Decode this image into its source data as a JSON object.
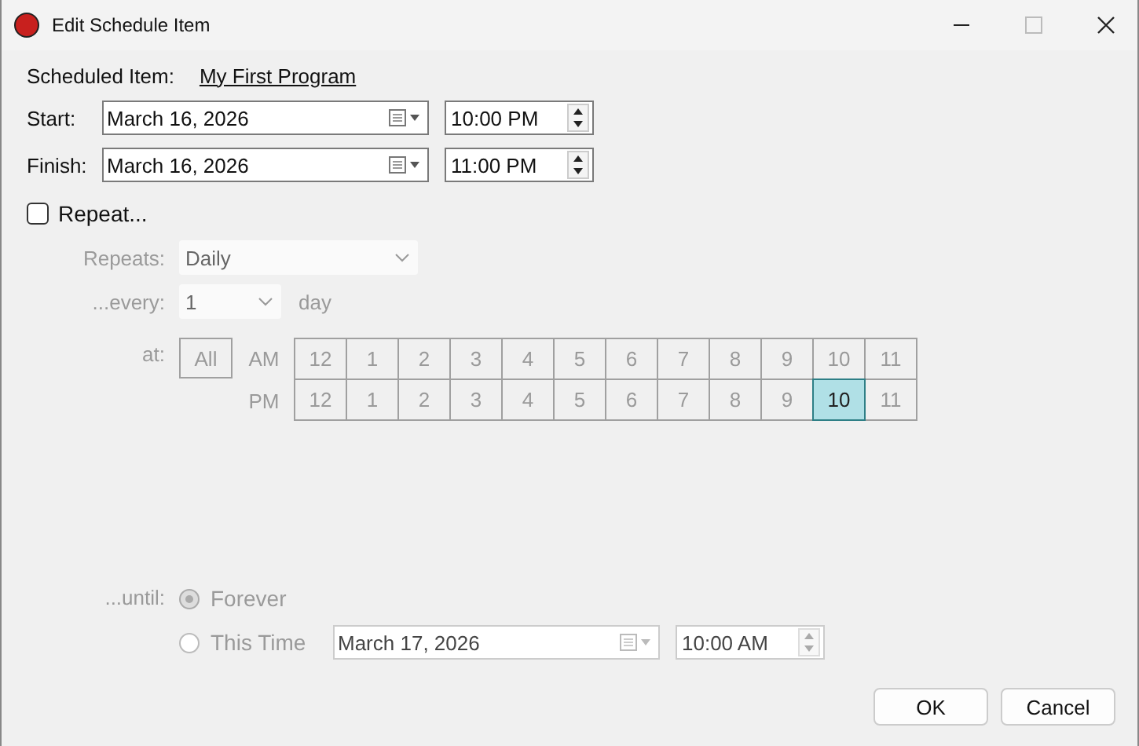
{
  "window": {
    "title": "Edit Schedule Item"
  },
  "scheduled_item": {
    "label": "Scheduled Item:",
    "value": "My First Program"
  },
  "start": {
    "label": "Start:",
    "date": "March 16, 2026",
    "time": "10:00 PM"
  },
  "finish": {
    "label": "Finish:",
    "date": "March 16, 2026",
    "time": "11:00 PM"
  },
  "repeat": {
    "label": "Repeat...",
    "checked": false
  },
  "repeats": {
    "label": "Repeats:",
    "value": "Daily"
  },
  "every": {
    "label": "...every:",
    "value": "1",
    "unit": "day"
  },
  "at": {
    "label": "at:",
    "all_button": "All",
    "rows": [
      {
        "label": "AM",
        "hours": [
          {
            "label": "12",
            "selected": false
          },
          {
            "label": "1",
            "selected": false
          },
          {
            "label": "2",
            "selected": false
          },
          {
            "label": "3",
            "selected": false
          },
          {
            "label": "4",
            "selected": false
          },
          {
            "label": "5",
            "selected": false
          },
          {
            "label": "6",
            "selected": false
          },
          {
            "label": "7",
            "selected": false
          },
          {
            "label": "8",
            "selected": false
          },
          {
            "label": "9",
            "selected": false
          },
          {
            "label": "10",
            "selected": false
          },
          {
            "label": "11",
            "selected": false
          }
        ]
      },
      {
        "label": "PM",
        "hours": [
          {
            "label": "12",
            "selected": false
          },
          {
            "label": "1",
            "selected": false
          },
          {
            "label": "2",
            "selected": false
          },
          {
            "label": "3",
            "selected": false
          },
          {
            "label": "4",
            "selected": false
          },
          {
            "label": "5",
            "selected": false
          },
          {
            "label": "6",
            "selected": false
          },
          {
            "label": "7",
            "selected": false
          },
          {
            "label": "8",
            "selected": false
          },
          {
            "label": "9",
            "selected": false
          },
          {
            "label": "10",
            "selected": true
          },
          {
            "label": "11",
            "selected": false
          }
        ]
      }
    ]
  },
  "until": {
    "label": "...until:",
    "options": [
      {
        "label": "Forever",
        "selected": true
      },
      {
        "label": "This Time",
        "selected": false
      }
    ],
    "date": "March 17, 2026",
    "time": "10:00 AM"
  },
  "buttons": [
    "OK",
    "Cancel"
  ]
}
